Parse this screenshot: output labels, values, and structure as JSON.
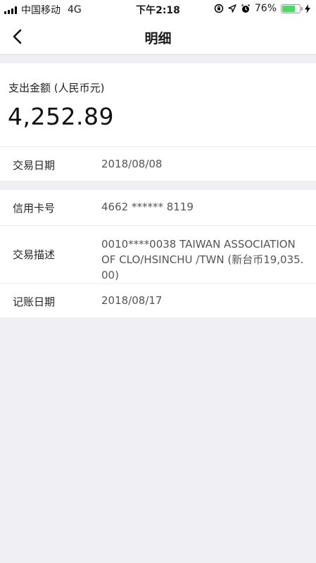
{
  "status_bar": {
    "carrier": "中国移动",
    "network": "4G",
    "time": "下午2:18",
    "battery_percent": "76%",
    "battery_level": 0.76,
    "icons": [
      "signal-icon",
      "rotation-lock-icon",
      "location-icon",
      "alarm-icon",
      "battery-icon",
      "charging-icon"
    ]
  },
  "nav": {
    "title": "明细",
    "back_icon": "chevron-left-icon"
  },
  "amount": {
    "label": "支出金额 (人民币元)",
    "value": "4,252.89"
  },
  "transaction_date": {
    "label": "交易日期",
    "value": "2018/08/08"
  },
  "details": [
    {
      "label": "信用卡号",
      "value": "4662 ****** 8119"
    },
    {
      "label": "交易描述",
      "value": "0010****0038 TAIWAN ASSOCIATION OF CLO/HSINCHU /TWN (新台币19,035.00)"
    },
    {
      "label": "记账日期",
      "value": "2018/08/17"
    }
  ],
  "colors": {
    "background": "#efeff4",
    "card": "#ffffff",
    "battery_fill": "#4cd964"
  }
}
